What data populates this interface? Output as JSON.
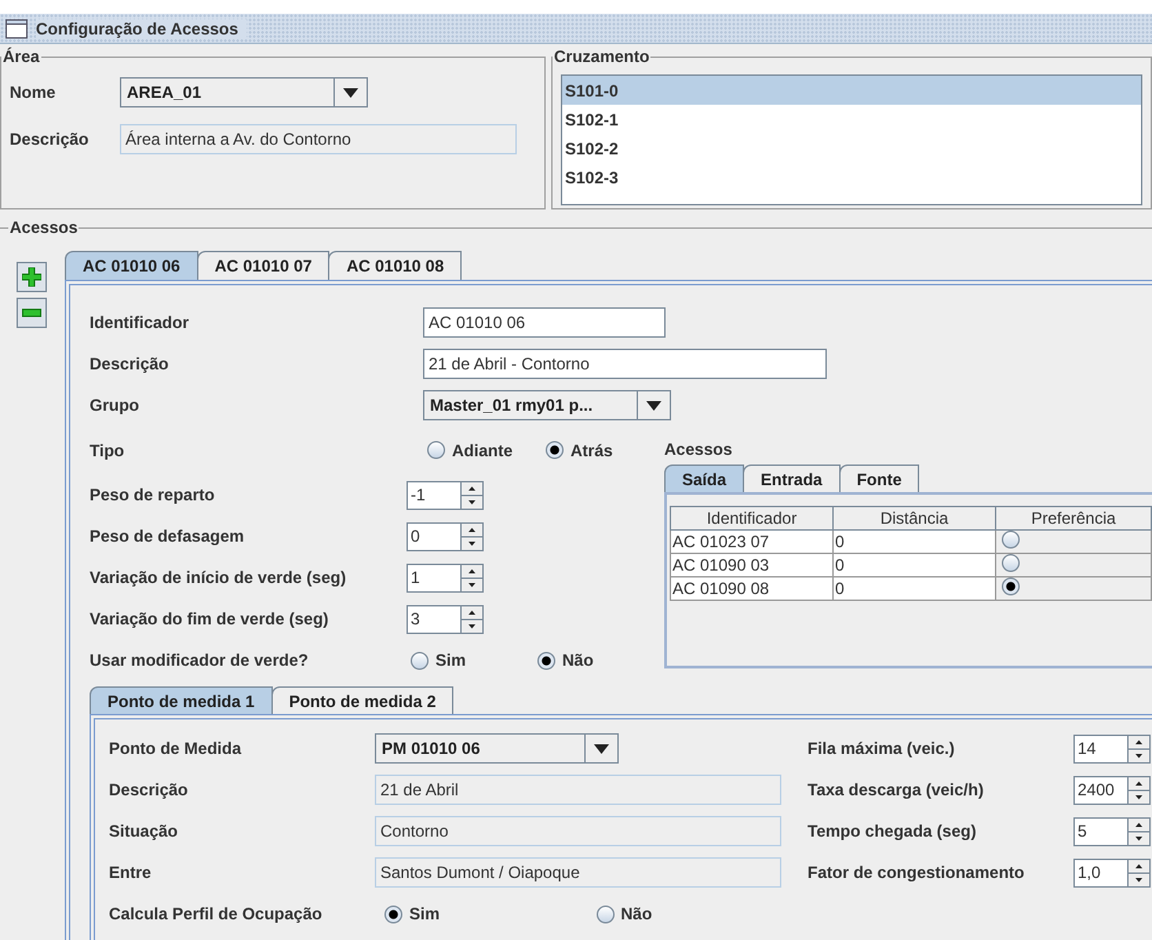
{
  "window": {
    "title": "Configuração de Acessos"
  },
  "area": {
    "legend": "Área",
    "fields": [
      {
        "label": "Nome",
        "kind": "combo",
        "value": "AREA_01"
      },
      {
        "label": "Descrição",
        "kind": "readonly",
        "value": "Área interna a Av. do Contorno"
      }
    ]
  },
  "cruzamento": {
    "legend": "Cruzamento",
    "items": [
      {
        "label": "S101-0",
        "selected": true
      },
      {
        "label": "S102-1",
        "selected": false
      },
      {
        "label": "S102-2",
        "selected": false
      },
      {
        "label": "S102-3",
        "selected": false
      }
    ]
  },
  "acessos": {
    "legend": "Acessos",
    "tabs": [
      {
        "label": "AC 01010 06",
        "selected": true
      },
      {
        "label": "AC 01010 07",
        "selected": false
      },
      {
        "label": "AC 01010 08",
        "selected": false
      }
    ],
    "top_fields": [
      {
        "label": "Identificador",
        "kind": "text",
        "value": "AC 01010 06"
      },
      {
        "label": "Descrição",
        "kind": "wide",
        "value": "21 de Abril  - Contorno"
      },
      {
        "label": "Grupo",
        "kind": "combo",
        "value": "Master_01 rmy01 p..."
      }
    ],
    "tipo": {
      "label": "Tipo",
      "options": [
        {
          "label": "Adiante",
          "selected": false
        },
        {
          "label": "Atrás",
          "selected": true
        }
      ]
    },
    "spinners": [
      {
        "label": "Peso de reparto",
        "value": "-1"
      },
      {
        "label": "Peso de defasagem",
        "value": "0"
      },
      {
        "label": "Variação de início de verde (seg)",
        "value": "1"
      },
      {
        "label": "Variação do fim de verde (seg)",
        "value": "3"
      }
    ],
    "modificador": {
      "label": "Usar modificador de verde?",
      "options": [
        {
          "label": "Sim",
          "selected": false
        },
        {
          "label": "Não",
          "selected": true
        }
      ]
    },
    "links": {
      "label": "Acessos",
      "tabs": [
        {
          "label": "Saída",
          "selected": true
        },
        {
          "label": "Entrada",
          "selected": false
        },
        {
          "label": "Fonte",
          "selected": false
        }
      ],
      "columns": [
        "Identificador",
        "Distância",
        "Preferência"
      ],
      "rows": [
        {
          "id": "AC 01023 07",
          "distance": "0",
          "selected": false
        },
        {
          "id": "AC 01090 03",
          "distance": "0",
          "selected": false
        },
        {
          "id": "AC 01090 08",
          "distance": "0",
          "selected": true
        }
      ]
    },
    "medida_tabs": [
      {
        "label": "Ponto de medida 1",
        "selected": true
      },
      {
        "label": "Ponto de medida 2",
        "selected": false
      }
    ],
    "medida": {
      "combo": {
        "label": "Ponto de Medida",
        "value": "PM 01010 06"
      },
      "left_fields": [
        {
          "label": "Descrição",
          "value": "21 de Abril"
        },
        {
          "label": "Situação",
          "value": "Contorno"
        },
        {
          "label": "Entre",
          "value": "Santos Dumont / Oiapoque"
        }
      ],
      "right_fields": [
        {
          "label": "Fila máxima (veic.)",
          "value": "14"
        },
        {
          "label": "Taxa descarga (veic/h)",
          "value": "2400"
        },
        {
          "label": "Tempo chegada (seg)",
          "value": "5"
        },
        {
          "label": "Fator de congestionamento",
          "value": "1,0"
        }
      ],
      "ocupacao": {
        "label": "Calcula Perfil de Ocupação",
        "options": [
          {
            "label": "Sim",
            "selected": true
          },
          {
            "label": "Não",
            "selected": false
          }
        ]
      }
    }
  }
}
